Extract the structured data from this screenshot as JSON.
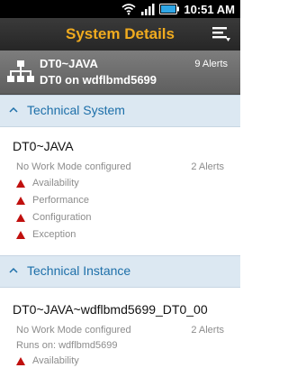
{
  "status_bar": {
    "time": "10:51 AM"
  },
  "header": {
    "title": "System Details",
    "menu_icon": "menu-icon"
  },
  "system_summary": {
    "name": "DT0~JAVA",
    "host_line": "DT0 on wdflbmd5699",
    "alerts": "9 Alerts",
    "icon": "hierarchy-icon"
  },
  "technical_system": {
    "section_title": "Technical System",
    "item": {
      "name": "DT0~JAVA",
      "work_mode": "No Work Mode configured",
      "alerts": "2 Alerts",
      "metrics": [
        "Availability",
        "Performance",
        "Configuration",
        "Exception"
      ]
    }
  },
  "technical_instance": {
    "section_title": "Technical Instance",
    "item": {
      "name": "DT0~JAVA~wdflbmd5699_DT0_00",
      "work_mode": "No Work Mode configured",
      "alerts": "2 Alerts",
      "runs_on": "Runs on: wdflbmd5699",
      "metrics": [
        "Availability"
      ]
    }
  },
  "colors": {
    "accent": "#f0ab1f",
    "link": "#1d6fa9",
    "alert_red": "#c0100e",
    "section_bg": "#dce8f2"
  }
}
